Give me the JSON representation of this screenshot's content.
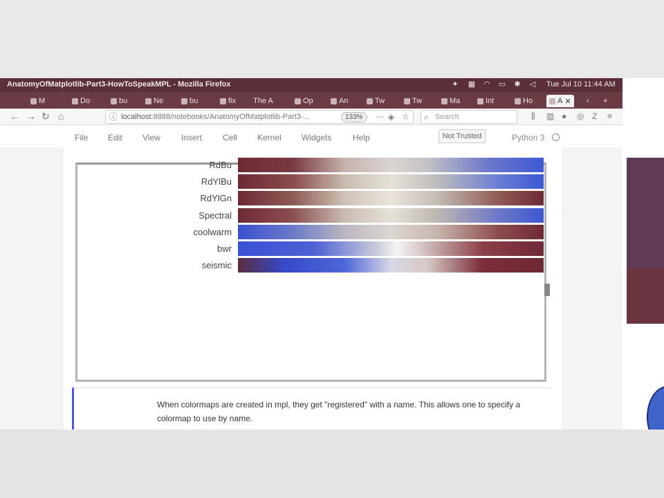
{
  "window": {
    "title": "AnatomyOfMatplotlib-Part3-HowToSpeakMPL - Mozilla Firefox",
    "clock": "Tue Jul 10 11:44 AM"
  },
  "tabs": [
    {
      "label": "M"
    },
    {
      "label": "Do"
    },
    {
      "label": "bu"
    },
    {
      "label": "Ne"
    },
    {
      "label": "bu"
    },
    {
      "label": "fix"
    },
    {
      "label": "The A"
    },
    {
      "label": "Op"
    },
    {
      "label": "An"
    },
    {
      "label": "Tw"
    },
    {
      "label": "Tw"
    },
    {
      "label": "Ma"
    },
    {
      "label": "Int"
    },
    {
      "label": "Ho"
    },
    {
      "label": "A"
    }
  ],
  "navbar": {
    "url_host": "localhost",
    "url_rest": ":8888/notebooks/AnatomyOfMatplotlib-Part3-...",
    "zoom": "133%",
    "search_placeholder": "Search"
  },
  "jupyter_menu": {
    "items": [
      "File",
      "Edit",
      "View",
      "Insert",
      "Cell",
      "Kernel",
      "Widgets",
      "Help"
    ],
    "trusted": "Not Trusted",
    "kernel": "Python 3"
  },
  "colormaps": [
    {
      "name": "RdBu",
      "stops": [
        "#6e2a35 0%",
        "#7a3a42 18%",
        "#c6b2ad 35%",
        "#d9d5d2 50%",
        "#c4c2c6 62%",
        "#6b78c9 82%",
        "#3e59d4 100%"
      ]
    },
    {
      "name": "RdYlBu",
      "stops": [
        "#6e2a35 0%",
        "#8a4c4a 18%",
        "#c9bcb0 35%",
        "#e6e2d8 50%",
        "#bfbcbc 65%",
        "#6c7fd4 85%",
        "#3c57d4 100%"
      ]
    },
    {
      "name": "RdYlGn",
      "stops": [
        "#6e2a35 0%",
        "#8e5a55 18%",
        "#cfc3b6 35%",
        "#e8e4dc 50%",
        "#c3bdb6 65%",
        "#905c56 85%",
        "#6e2a35 100%"
      ]
    },
    {
      "name": "Spectral",
      "stops": [
        "#6e2a35 0%",
        "#8c4f50 18%",
        "#c9bdb2 35%",
        "#e5e1d9 50%",
        "#bfb7b1 65%",
        "#6d78c7 85%",
        "#3d57d3 100%"
      ]
    },
    {
      "name": "coolwarm",
      "stops": [
        "#3b52d0 0%",
        "#6b7ac8 18%",
        "#b9b6c1 35%",
        "#dcd7d2 50%",
        "#c7b6ae 65%",
        "#8d4c4c 85%",
        "#6e2a35 100%"
      ]
    },
    {
      "name": "bwr",
      "stops": [
        "#3a50d6 0%",
        "#4d61d4 25%",
        "#c9c9d9 45%",
        "#f4f4f4 52%",
        "#d4c7c5 60%",
        "#8c3f48 80%",
        "#6e2a35 100%"
      ]
    },
    {
      "name": "seismic",
      "stops": [
        "#5a2d40 0%",
        "#3649c8 15%",
        "#4e67d8 35%",
        "#d8d8e6 50%",
        "#d6c8c5 62%",
        "#7a2d3a 80%",
        "#6e2a35 100%"
      ]
    }
  ],
  "markdown_cell": {
    "text": "When colormaps are created in mpl, they get \"registered\" with a name. This allows one to specify a colormap to use by name."
  },
  "colors": {
    "titlebar": "#5a2f36",
    "tabstrip": "#6a3b43",
    "cell_accent": "#4a5bd6"
  }
}
